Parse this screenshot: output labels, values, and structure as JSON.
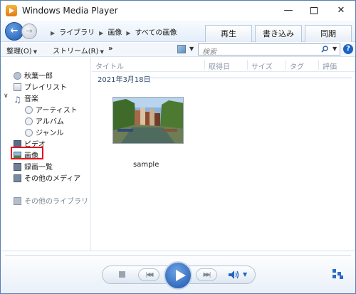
{
  "window": {
    "title": "Windows Media Player",
    "min_glyph": "—",
    "close_glyph": "✕"
  },
  "nav": {
    "back_glyph": "←",
    "forward_glyph": "→",
    "breadcrumbs": [
      "ライブラリ",
      "画像",
      "すべての画像"
    ],
    "tabs": [
      "再生",
      "書き込み",
      "同期"
    ]
  },
  "toolbar": {
    "organize": "整理(O)",
    "stream": "ストリーム(R)",
    "more": "»",
    "search_placeholder": "検索"
  },
  "sidebar": {
    "user": "秋葉一郎",
    "playlist": "プレイリスト",
    "music": "音楽",
    "artist": "アーティスト",
    "album": "アルバム",
    "genre": "ジャンル",
    "video": "ビデオ",
    "picture": "画像",
    "recorded_tv": "録画一覧",
    "other_media": "その他のメディア",
    "other_libraries": "その他のライブラリ"
  },
  "main": {
    "columns": [
      "タイトル",
      "取得日",
      "サイズ",
      "タグ",
      "評価"
    ],
    "group_date": "2021年3月18日",
    "items": [
      {
        "label": "sample"
      }
    ]
  },
  "colors": {
    "accent": "#1d63c6",
    "highlight": "#e8121b"
  },
  "icons": {
    "app": "media-player-icon",
    "search": "search-icon",
    "help": "help-icon",
    "switch": "switch-to-now-playing-icon"
  }
}
